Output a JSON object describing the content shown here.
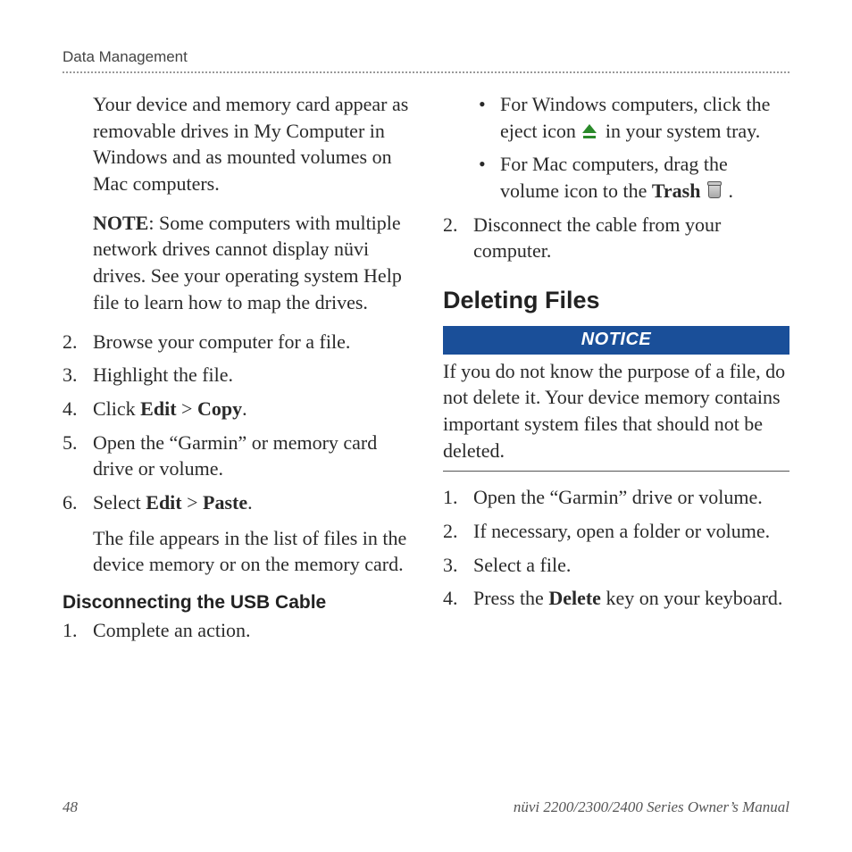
{
  "header": {
    "section": "Data Management"
  },
  "left": {
    "para1": "Your device and memory card appear as removable drives in My Computer in Windows and as mounted volumes on Mac computers.",
    "note_label": "NOTE",
    "note_body": ": Some computers with multiple network drives cannot display nüvi drives. See your operating system Help file to learn how to map the drives.",
    "steps": {
      "s2": {
        "n": "2.",
        "t": "Browse your computer for a file."
      },
      "s3": {
        "n": "3.",
        "t": "Highlight the file."
      },
      "s4": {
        "n": "4.",
        "pre": "Click ",
        "b1": "Edit",
        "mid": " > ",
        "b2": "Copy",
        "post": "."
      },
      "s5": {
        "n": "5.",
        "t": "Open the “Garmin” or memory card drive or volume."
      },
      "s6": {
        "n": "6.",
        "pre": "Select ",
        "b1": "Edit",
        "mid": " > ",
        "b2": "Paste",
        "post": ".",
        "tail": "The file appears in the list of files in the device memory or on the memory card."
      }
    },
    "subheading": "Disconnecting the USB Cable",
    "disc_s1": {
      "n": "1.",
      "t": "Complete an action."
    }
  },
  "right": {
    "bullets": {
      "b1": {
        "pre": "For Windows computers, click the eject icon ",
        "post": " in your system tray."
      },
      "b2": {
        "pre": "For Mac computers, drag the volume icon to the ",
        "bold": "Trash",
        "post": " ."
      }
    },
    "s2": {
      "n": "2.",
      "t": "Disconnect the cable from your computer."
    },
    "h2": "Deleting Files",
    "notice_label": "NOTICE",
    "notice_text": "If you do not know the purpose of a file, do not delete it. Your device memory contains important system files that should not be deleted.",
    "del": {
      "s1": {
        "n": "1.",
        "t": "Open the “Garmin” drive or volume."
      },
      "s2": {
        "n": "2.",
        "t": "If necessary, open a folder or volume."
      },
      "s3": {
        "n": "3.",
        "t": "Select a file."
      },
      "s4": {
        "n": "4.",
        "pre": "Press the ",
        "bold": "Delete",
        "post": " key on your keyboard."
      }
    }
  },
  "footer": {
    "page": "48",
    "title": "nüvi 2200/2300/2400 Series Owner’s Manual"
  }
}
